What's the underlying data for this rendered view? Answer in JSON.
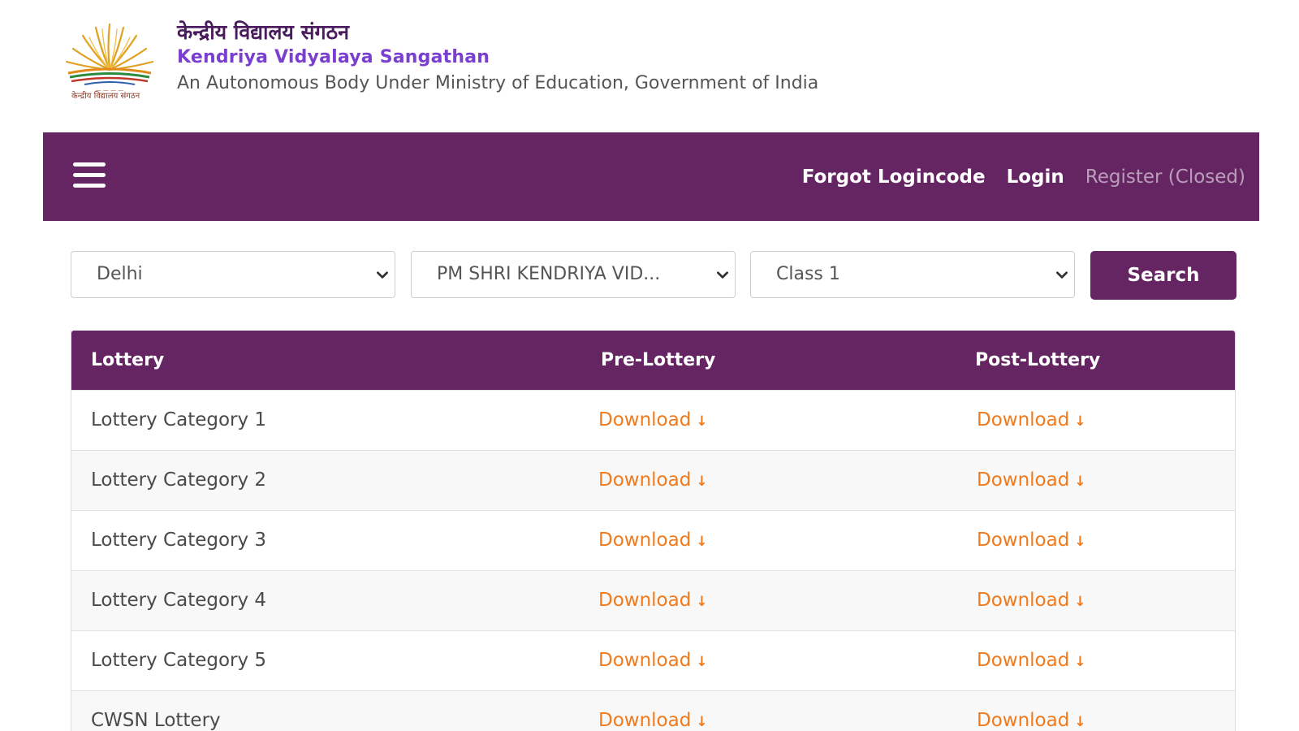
{
  "header": {
    "hindi_title": "केन्द्रीय विद्यालय संगठन",
    "english_title": "Kendriya Vidyalaya Sangathan",
    "tagline": "An Autonomous Body Under Ministry of Education, Government of India",
    "logo_caption": "केन्द्रीय विद्यालय संगठन"
  },
  "navbar": {
    "links": {
      "forgot": "Forgot Logincode",
      "login": "Login",
      "register": "Register (Closed)"
    }
  },
  "filters": {
    "region": "Delhi",
    "school": "PM SHRI KENDRIYA VID...",
    "class": "Class 1",
    "search_label": "Search"
  },
  "table": {
    "headers": {
      "lottery": "Lottery",
      "pre": "Pre-Lottery",
      "post": "Post-Lottery"
    },
    "download_label": "Download",
    "download_arrow": "↓",
    "rows": [
      {
        "name": "Lottery Category 1"
      },
      {
        "name": "Lottery Category 2"
      },
      {
        "name": "Lottery Category 3"
      },
      {
        "name": "Lottery Category 4"
      },
      {
        "name": "Lottery Category 5"
      },
      {
        "name": "CWSN Lottery"
      }
    ]
  },
  "colors": {
    "primary": "#652563",
    "accent_text": "#7b3fd0",
    "download": "#f07a1c"
  }
}
